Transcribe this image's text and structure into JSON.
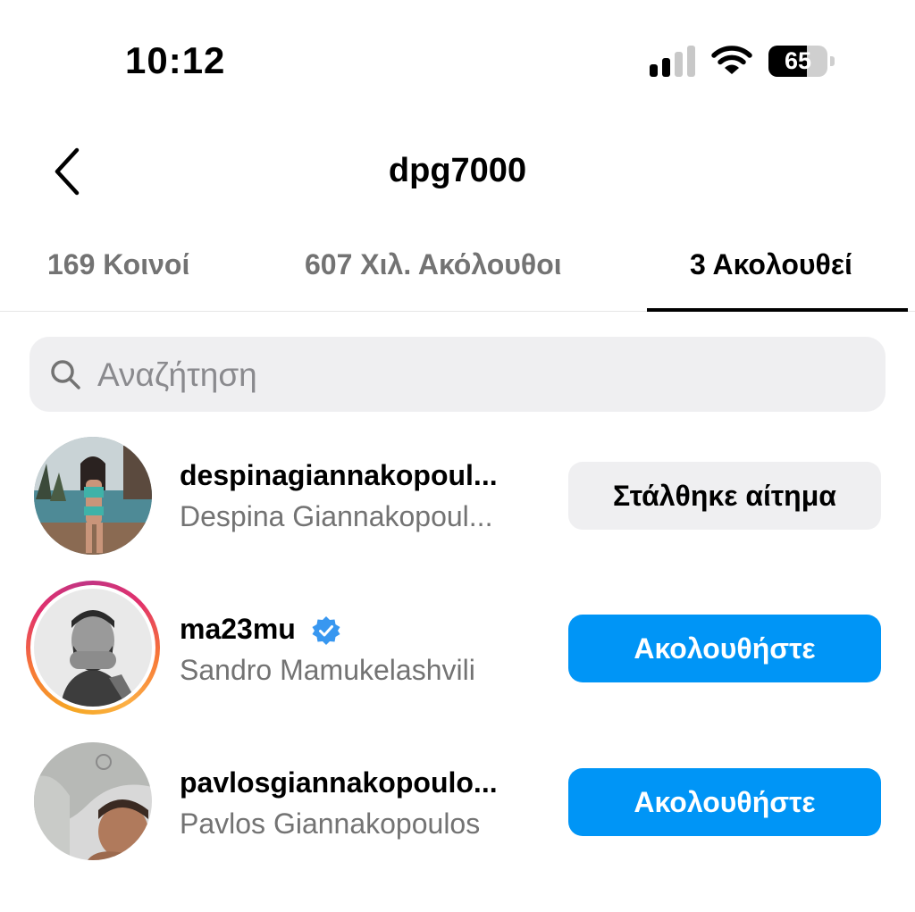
{
  "status_bar": {
    "time": "10:12",
    "battery_level": "65",
    "battery_fill_fraction": 0.65,
    "icons": [
      "cellular-signal-icon",
      "wifi-icon",
      "battery-icon"
    ]
  },
  "header": {
    "title": "dpg7000",
    "back_icon": "chevron-left-icon"
  },
  "tabs": [
    {
      "label": "169 Κοινοί",
      "active": false
    },
    {
      "label": "607 Χιλ. Ακόλουθοι",
      "active": false
    },
    {
      "label": "3 Ακολουθεί",
      "active": true
    }
  ],
  "search": {
    "placeholder": "Αναζήτηση",
    "value": "",
    "icon": "search-icon"
  },
  "accounts": [
    {
      "username": "despinagiannakopoul...",
      "full_name": "Despina Giannakopoul...",
      "verified": false,
      "has_story": false,
      "button_label": "Στάλθηκε αίτημα",
      "button_style": "requested"
    },
    {
      "username": "ma23mu",
      "full_name": "Sandro Mamukelashvili",
      "verified": true,
      "has_story": true,
      "button_label": "Ακολουθήστε",
      "button_style": "follow"
    },
    {
      "username": "pavlosgiannakopoulo...",
      "full_name": "Pavlos Giannakopoulos",
      "verified": false,
      "has_story": false,
      "button_label": "Ακολουθήστε",
      "button_style": "follow"
    }
  ],
  "colors": {
    "follow_button": "#0095f6",
    "requested_button": "#efeff1",
    "secondary_text": "#737373",
    "verified_badge": "#3897f0"
  }
}
